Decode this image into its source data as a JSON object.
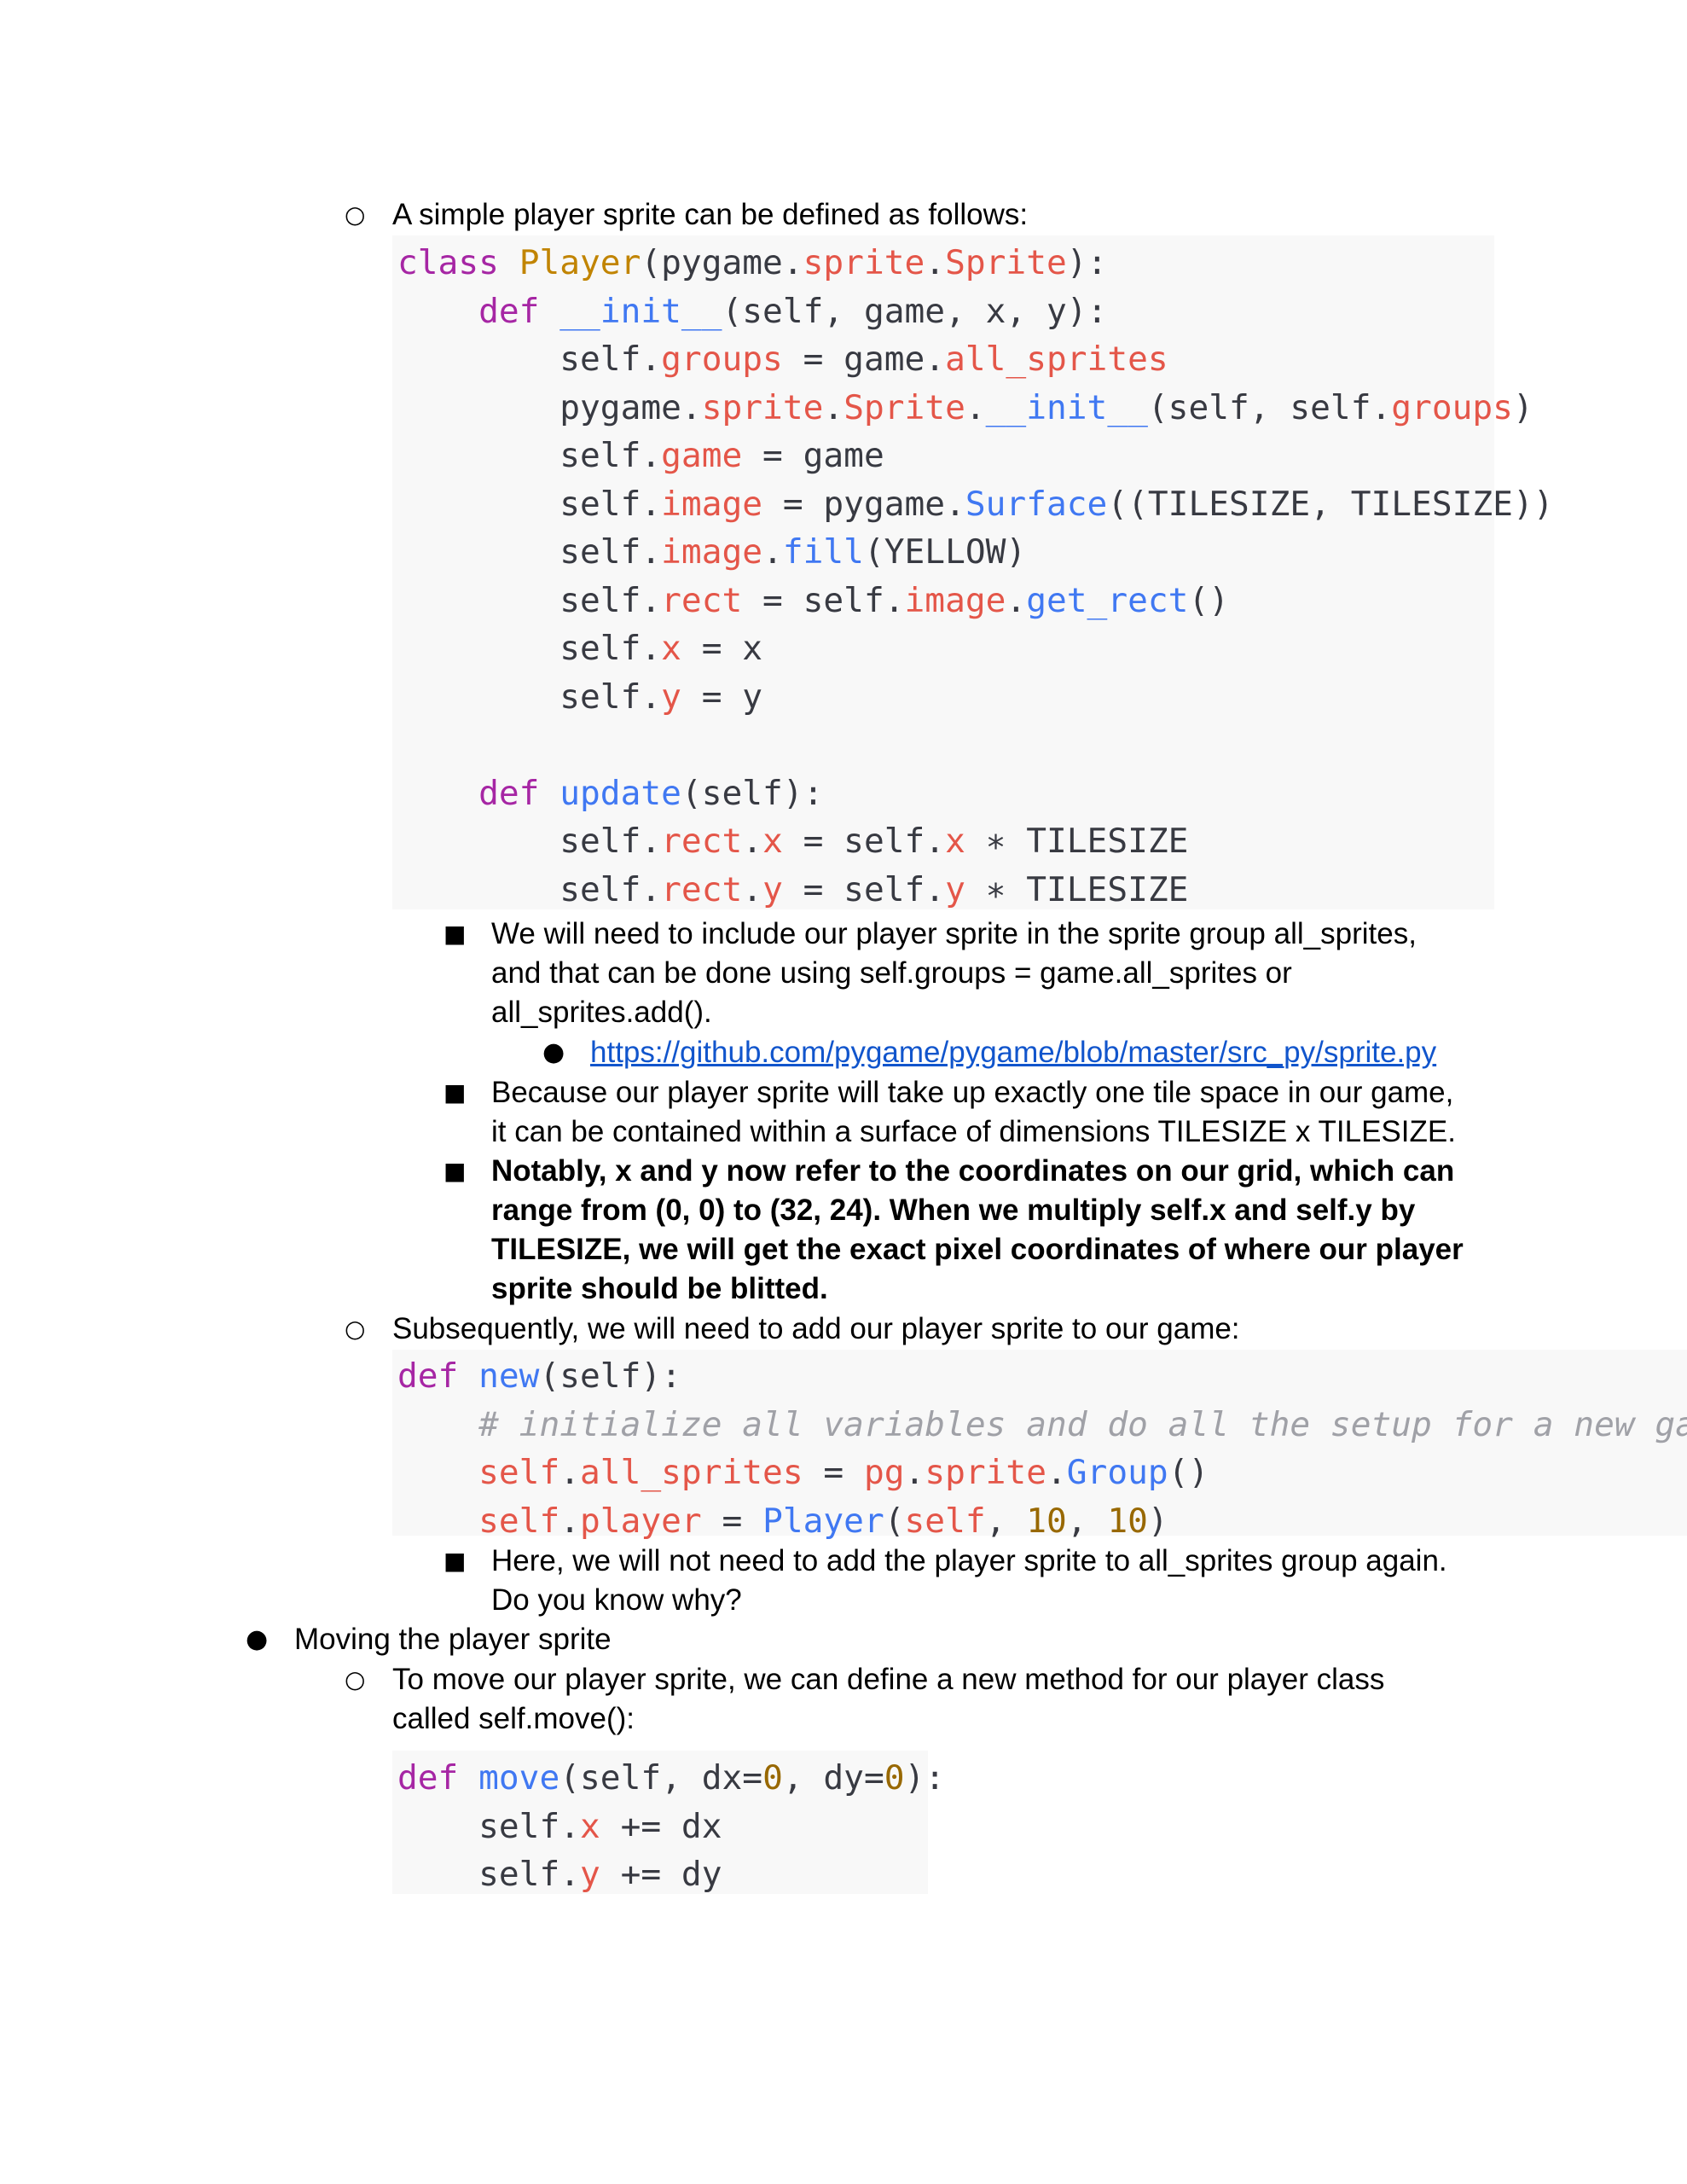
{
  "intro_bullet": {
    "text": "A simple player sprite can be defined as follows:"
  },
  "code1": {
    "lines": [
      [
        {
          "t": "class",
          "c": "kw"
        },
        {
          "t": " "
        },
        {
          "t": "Player",
          "c": "cls"
        },
        {
          "t": "(pygame."
        },
        {
          "t": "sprite",
          "c": "at"
        },
        {
          "t": "."
        },
        {
          "t": "Sprite",
          "c": "at"
        },
        {
          "t": "):"
        }
      ],
      [
        {
          "t": "    "
        },
        {
          "t": "def",
          "c": "kw"
        },
        {
          "t": " "
        },
        {
          "t": "__init__",
          "c": "fn"
        },
        {
          "t": "(self, game, x, y):"
        }
      ],
      [
        {
          "t": "        self."
        },
        {
          "t": "groups",
          "c": "at"
        },
        {
          "t": " = game."
        },
        {
          "t": "all_sprites",
          "c": "at"
        }
      ],
      [
        {
          "t": "        pygame."
        },
        {
          "t": "sprite",
          "c": "at"
        },
        {
          "t": "."
        },
        {
          "t": "Sprite",
          "c": "at"
        },
        {
          "t": "."
        },
        {
          "t": "__init__",
          "c": "fn"
        },
        {
          "t": "(self, self."
        },
        {
          "t": "groups",
          "c": "at"
        },
        {
          "t": ")"
        }
      ],
      [
        {
          "t": "        self."
        },
        {
          "t": "game",
          "c": "at"
        },
        {
          "t": " = game"
        }
      ],
      [
        {
          "t": "        self."
        },
        {
          "t": "image",
          "c": "at"
        },
        {
          "t": " = pygame."
        },
        {
          "t": "Surface",
          "c": "fn"
        },
        {
          "t": "((TILESIZE, TILESIZE))"
        }
      ],
      [
        {
          "t": "        self."
        },
        {
          "t": "image",
          "c": "at"
        },
        {
          "t": "."
        },
        {
          "t": "fill",
          "c": "fn"
        },
        {
          "t": "(YELLOW)"
        }
      ],
      [
        {
          "t": "        self."
        },
        {
          "t": "rect",
          "c": "at"
        },
        {
          "t": " = self."
        },
        {
          "t": "image",
          "c": "at"
        },
        {
          "t": "."
        },
        {
          "t": "get_rect",
          "c": "fn"
        },
        {
          "t": "()"
        }
      ],
      [
        {
          "t": "        self."
        },
        {
          "t": "x",
          "c": "at"
        },
        {
          "t": " = x"
        }
      ],
      [
        {
          "t": "        self."
        },
        {
          "t": "y",
          "c": "at"
        },
        {
          "t": " = y"
        }
      ],
      [],
      [
        {
          "t": "    "
        },
        {
          "t": "def",
          "c": "kw"
        },
        {
          "t": " "
        },
        {
          "t": "update",
          "c": "fn"
        },
        {
          "t": "(self):"
        }
      ],
      [
        {
          "t": "        self."
        },
        {
          "t": "rect",
          "c": "at"
        },
        {
          "t": "."
        },
        {
          "t": "x",
          "c": "at"
        },
        {
          "t": " = self."
        },
        {
          "t": "x",
          "c": "at"
        },
        {
          "t": " ∗ TILESIZE"
        }
      ],
      [
        {
          "t": "        self."
        },
        {
          "t": "rect",
          "c": "at"
        },
        {
          "t": "."
        },
        {
          "t": "y",
          "c": "at"
        },
        {
          "t": " = self."
        },
        {
          "t": "y",
          "c": "at"
        },
        {
          "t": " ∗ TILESIZE"
        }
      ]
    ]
  },
  "note1": {
    "lines": [
      "We will need to include our player sprite in the sprite group all_sprites,",
      "and that can be done using self.groups = game.all_sprites or",
      "all_sprites.add()."
    ]
  },
  "link1": {
    "text": "https://github.com/pygame/pygame/blob/master/src_py/sprite.py"
  },
  "note2": {
    "lines": [
      "Because our player sprite will take up exactly one tile space in our game,",
      "it can be contained within a surface of dimensions TILESIZE x TILESIZE."
    ]
  },
  "note3": {
    "lines": [
      "Notably, x and y now refer to the coordinates on our grid, which can",
      "range from (0, 0) to (32, 24). When we multiply self.x and self.y by",
      "TILESIZE, we will get the exact pixel coordinates of where our player",
      "sprite should be blitted."
    ]
  },
  "sub_bullet": {
    "text": "Subsequently, we will need to add our player sprite to our game:"
  },
  "code2": {
    "lines": [
      [
        {
          "t": "def",
          "c": "kw"
        },
        {
          "t": " "
        },
        {
          "t": "new",
          "c": "fn"
        },
        {
          "t": "(self):"
        }
      ],
      [
        {
          "t": "    "
        },
        {
          "t": "# initialize all variables and do all the setup for a new game",
          "c": "cm"
        }
      ],
      [
        {
          "t": "    "
        },
        {
          "t": "self",
          "c": "at"
        },
        {
          "t": "."
        },
        {
          "t": "all_sprites",
          "c": "at"
        },
        {
          "t": " = "
        },
        {
          "t": "pg",
          "c": "at"
        },
        {
          "t": "."
        },
        {
          "t": "sprite",
          "c": "at"
        },
        {
          "t": "."
        },
        {
          "t": "Group",
          "c": "fn"
        },
        {
          "t": "()"
        }
      ],
      [
        {
          "t": "    "
        },
        {
          "t": "self",
          "c": "at"
        },
        {
          "t": "."
        },
        {
          "t": "player",
          "c": "at"
        },
        {
          "t": " = "
        },
        {
          "t": "Player",
          "c": "fn"
        },
        {
          "t": "("
        },
        {
          "t": "self",
          "c": "at"
        },
        {
          "t": ", "
        },
        {
          "t": "10",
          "c": "num"
        },
        {
          "t": ", "
        },
        {
          "t": "10",
          "c": "num"
        },
        {
          "t": ")"
        }
      ]
    ]
  },
  "note4": {
    "lines": [
      "Here, we will not need to add the player sprite to all_sprites group again.",
      "Do you know why?"
    ]
  },
  "heading_bullet": {
    "text": "Moving the player sprite"
  },
  "move_bullet": {
    "lines": [
      "To move our player sprite, we can define a new method for our player class",
      "called self.move():"
    ]
  },
  "code3": {
    "lines": [
      [
        {
          "t": "def",
          "c": "kw"
        },
        {
          "t": " "
        },
        {
          "t": "move",
          "c": "fn"
        },
        {
          "t": "(self, dx="
        },
        {
          "t": "0",
          "c": "num"
        },
        {
          "t": ", dy="
        },
        {
          "t": "0",
          "c": "num"
        },
        {
          "t": "):"
        }
      ],
      [
        {
          "t": "    self."
        },
        {
          "t": "x",
          "c": "at"
        },
        {
          "t": " += dx"
        }
      ],
      [
        {
          "t": "    self."
        },
        {
          "t": "y",
          "c": "at"
        },
        {
          "t": " += dy"
        }
      ]
    ]
  }
}
